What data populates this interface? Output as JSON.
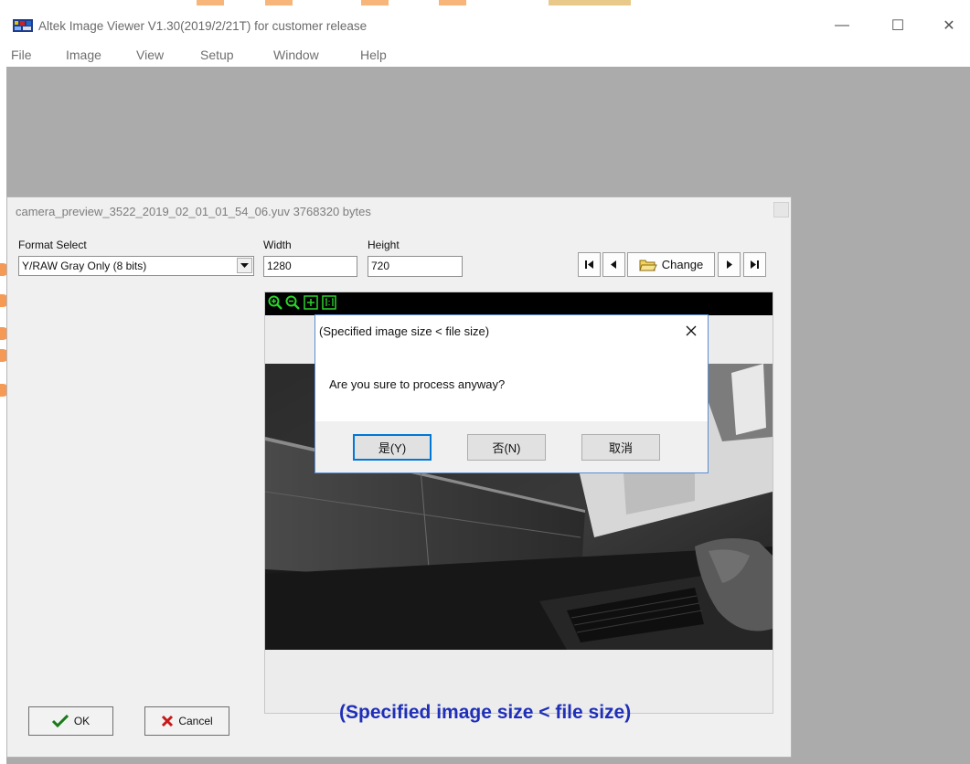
{
  "window": {
    "title": "Altek Image Viewer V1.30(2019/2/21T)  for customer release",
    "minimize_glyph": "—",
    "maximize_glyph": "☐",
    "close_glyph": "✕"
  },
  "menu": [
    "File",
    "Image",
    "View",
    "Setup",
    "Window",
    "Help"
  ],
  "child": {
    "title": "camera_preview_3522_2019_02_01_01_54_06.yuv 3768320 bytes",
    "format_label": "Format Select",
    "format_value": "Y/RAW Gray Only (8 bits)",
    "width_label": "Width",
    "width_value": "1280",
    "height_label": "Height",
    "height_value": "720",
    "change_label": "Change",
    "status_text": "(Specified image size < file size)",
    "ok_label": "OK",
    "cancel_label": "Cancel"
  },
  "dialog": {
    "title": "(Specified image size < file size)",
    "message": "Are you sure to process anyway?",
    "yes_label": "是(Y)",
    "no_label": "否(N)",
    "cancel_label": "取消"
  },
  "colors": {
    "accent": "#0078d7",
    "status_text": "#1f2fb8",
    "mdi_background": "#ababab",
    "zoom_icon": "#2bd42b"
  },
  "icons": [
    "app-icon",
    "zoom-in-icon",
    "zoom-out-icon",
    "fit-to-window-icon",
    "actual-size-icon",
    "first-icon",
    "previous-icon",
    "folder-open-icon",
    "next-icon",
    "last-icon",
    "checkmark-icon",
    "cross-icon",
    "close-icon",
    "dropdown-arrow-icon"
  ]
}
